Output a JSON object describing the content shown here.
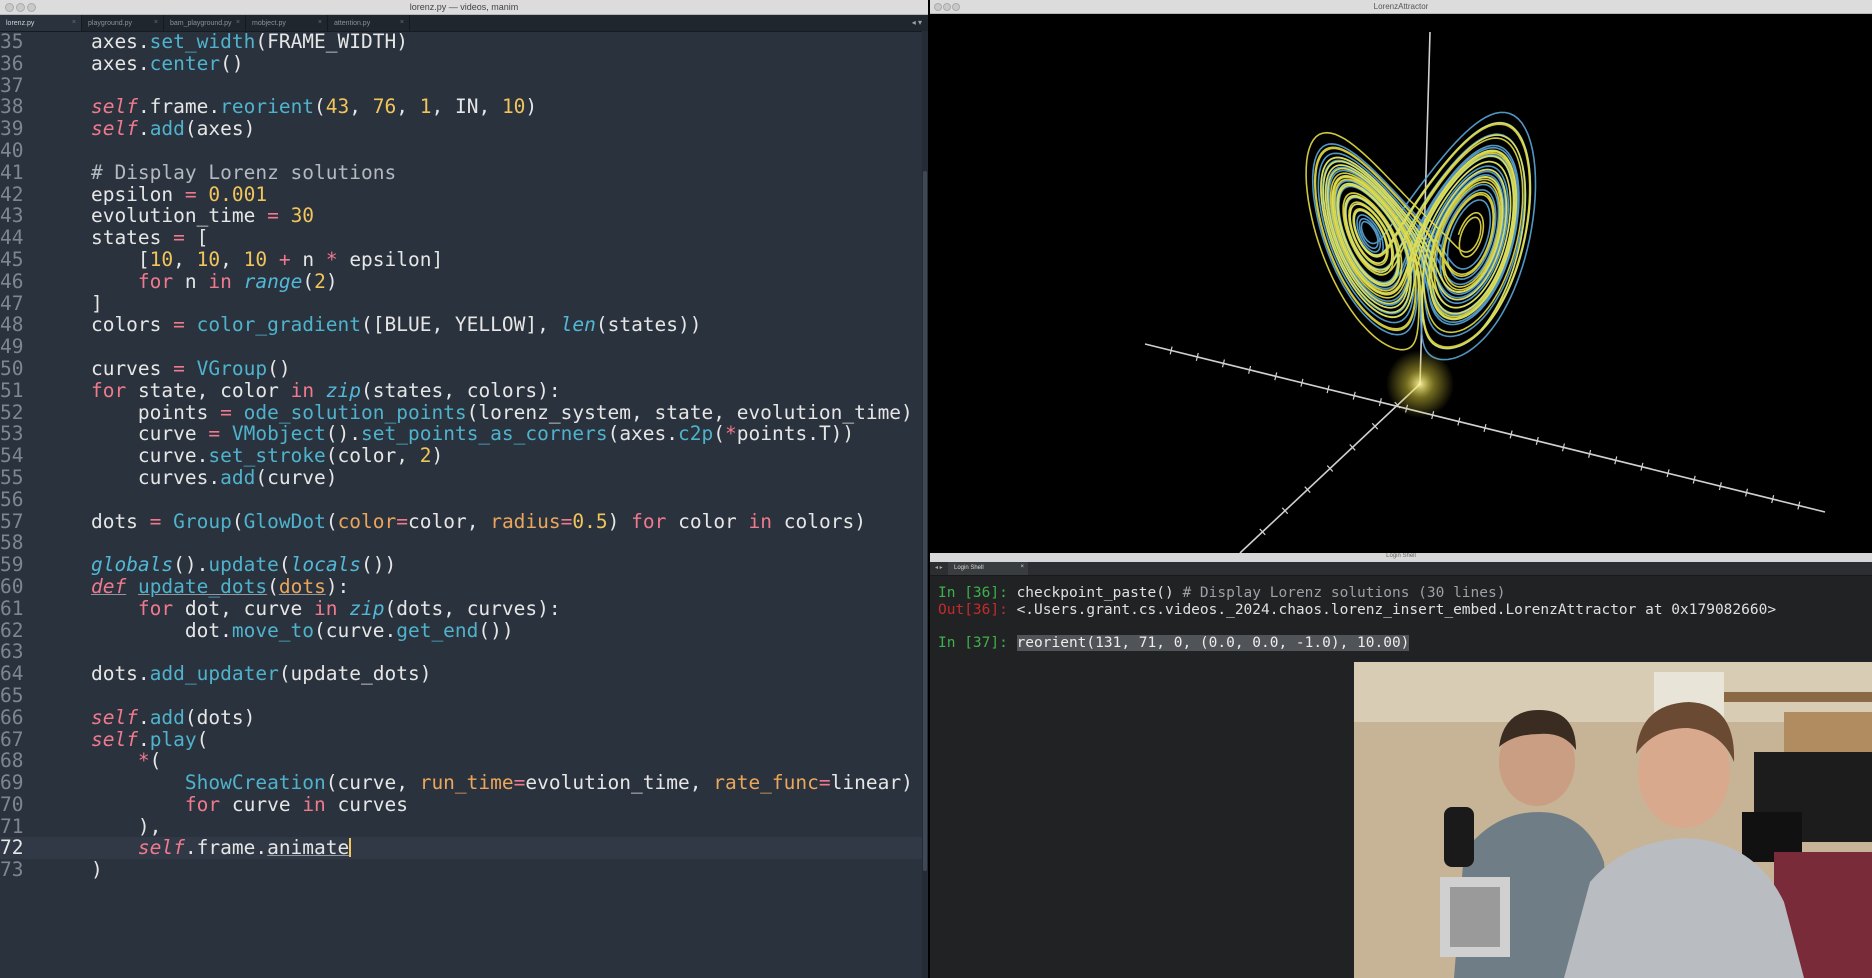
{
  "editor": {
    "window_title": "lorenz.py — videos, manim",
    "tabs": [
      {
        "label": "lorenz.py",
        "active": true
      },
      {
        "label": "playground.py",
        "active": false
      },
      {
        "label": "bam_playground.py",
        "active": false
      },
      {
        "label": "mobject.py",
        "active": false
      },
      {
        "label": "attention.py",
        "active": false
      }
    ],
    "tab_nav": "◂ ▾",
    "current_line": "72",
    "lines": [
      {
        "num": "35",
        "html": "    axes.<span class='f'>set_width</span>(FRAME_WIDTH)"
      },
      {
        "num": "36",
        "html": "    axes.<span class='f'>center</span>()"
      },
      {
        "num": "37",
        "html": ""
      },
      {
        "num": "38",
        "html": "    <span class='s'>self</span>.frame.<span class='f'>reorient</span>(<span class='n'>43</span>, <span class='n'>76</span>, <span class='n'>1</span>, IN, <span class='n'>10</span>)"
      },
      {
        "num": "39",
        "html": "    <span class='s'>self</span>.<span class='f'>add</span>(axes)"
      },
      {
        "num": "40",
        "html": ""
      },
      {
        "num": "41",
        "html": "    <span class='c'># Display Lorenz solutions</span>"
      },
      {
        "num": "42",
        "html": "    epsilon <span class='o'>=</span> <span class='n'>0.001</span>"
      },
      {
        "num": "43",
        "html": "    evolution_time <span class='o'>=</span> <span class='n'>30</span>"
      },
      {
        "num": "44",
        "html": "    states <span class='o'>=</span> ["
      },
      {
        "num": "45",
        "html": "        [<span class='n'>10</span>, <span class='n'>10</span>, <span class='n'>10</span> <span class='o'>+</span> n <span class='o'>*</span> epsilon]"
      },
      {
        "num": "46",
        "html": "        <span class='k'>for</span> n <span class='k'>in</span> <span class='b'>range</span>(<span class='n'>2</span>)"
      },
      {
        "num": "47",
        "html": "    ]"
      },
      {
        "num": "48",
        "html": "    colors <span class='o'>=</span> <span class='f'>color_gradient</span>([BLUE, YELLOW], <span class='b'>len</span>(states))"
      },
      {
        "num": "49",
        "html": ""
      },
      {
        "num": "50",
        "html": "    curves <span class='o'>=</span> <span class='f'>VGroup</span>()"
      },
      {
        "num": "51",
        "html": "    <span class='k'>for</span> state, color <span class='k'>in</span> <span class='b'>zip</span>(states, colors):"
      },
      {
        "num": "52",
        "html": "        points <span class='o'>=</span> <span class='f'>ode_solution_points</span>(lorenz_system, state, evolution_time)"
      },
      {
        "num": "53",
        "html": "        curve <span class='o'>=</span> <span class='f'>VMobject</span>().<span class='f'>set_points_as_corners</span>(axes.<span class='f'>c2p</span>(<span class='o'>*</span>points.T))"
      },
      {
        "num": "54",
        "html": "        curve.<span class='f'>set_stroke</span>(color, <span class='n'>2</span>)"
      },
      {
        "num": "55",
        "html": "        curves.<span class='f'>add</span>(curve)"
      },
      {
        "num": "56",
        "html": ""
      },
      {
        "num": "57",
        "html": "    dots <span class='o'>=</span> <span class='f'>Group</span>(<span class='f'>GlowDot</span>(<span class='p'>color</span><span class='o'>=</span>color, <span class='p'>radius</span><span class='o'>=</span><span class='n'>0.5</span>) <span class='k'>for</span> color <span class='k'>in</span> colors)"
      },
      {
        "num": "58",
        "html": ""
      },
      {
        "num": "59",
        "html": "    <span class='b'>globals</span>().<span class='f'>update</span>(<span class='b'>locals</span>())"
      },
      {
        "num": "60",
        "html": "    <span class='s u'>def</span> <span class='f u'>update_dots</span>(<span class='p u'>dots</span>):"
      },
      {
        "num": "61",
        "html": "        <span class='k'>for</span> dot, curve <span class='k'>in</span> <span class='b'>zip</span>(dots, curves):"
      },
      {
        "num": "62",
        "html": "            dot.<span class='f'>move_to</span>(curve.<span class='f'>get_end</span>())"
      },
      {
        "num": "63",
        "html": ""
      },
      {
        "num": "64",
        "html": "    dots.<span class='f'>add_updater</span>(update_dots)"
      },
      {
        "num": "65",
        "html": ""
      },
      {
        "num": "66",
        "html": "    <span class='s'>self</span>.<span class='f'>add</span>(dots)"
      },
      {
        "num": "67",
        "html": "    <span class='s'>self</span>.<span class='f'>play</span>("
      },
      {
        "num": "68",
        "html": "        <span class='o'>*</span>("
      },
      {
        "num": "69",
        "html": "            <span class='f'>ShowCreation</span>(curve, <span class='p'>run_time</span><span class='o'>=</span>evolution_time, <span class='p'>rate_func</span><span class='o'>=</span>linear)"
      },
      {
        "num": "70",
        "html": "            <span class='k'>for</span> curve <span class='k'>in</span> curves"
      },
      {
        "num": "71",
        "html": "        ),"
      },
      {
        "num": "72",
        "html": "        <span class='s'>self</span>.frame.<span class='u'>animate</span><span class='cursor'></span>"
      },
      {
        "num": "73",
        "html": "    )"
      }
    ]
  },
  "render_window": {
    "title": "LorenzAttractor",
    "colors": {
      "blue": "#5aa6d8",
      "yellow": "#f2ea4a",
      "axes": "#d0d0d0"
    }
  },
  "terminal": {
    "window_title": "Login Shell",
    "tab_label": "Login Shell",
    "lines": [
      {
        "prompt": "In [36]: ",
        "prompt_class": "in",
        "text": "checkpoint_paste() ",
        "comment": "# Display Lorenz solutions (30 lines)",
        "selected": false
      },
      {
        "prompt": "Out[36]: ",
        "prompt_class": "out",
        "text": "<.Users.grant.cs.videos._2024.chaos.lorenz_insert_embed.LorenzAttractor at 0x179082660>",
        "comment": "",
        "selected": false
      },
      {
        "prompt": "",
        "prompt_class": "in",
        "text": "",
        "comment": "",
        "selected": false
      },
      {
        "prompt": "In [37]: ",
        "prompt_class": "in",
        "text": "reorient(131, 71, 0, (0.0, 0.0, -1.0), 10.00)",
        "comment": "",
        "selected": true
      }
    ]
  },
  "webcam": {
    "label": "presenter-webcam"
  }
}
